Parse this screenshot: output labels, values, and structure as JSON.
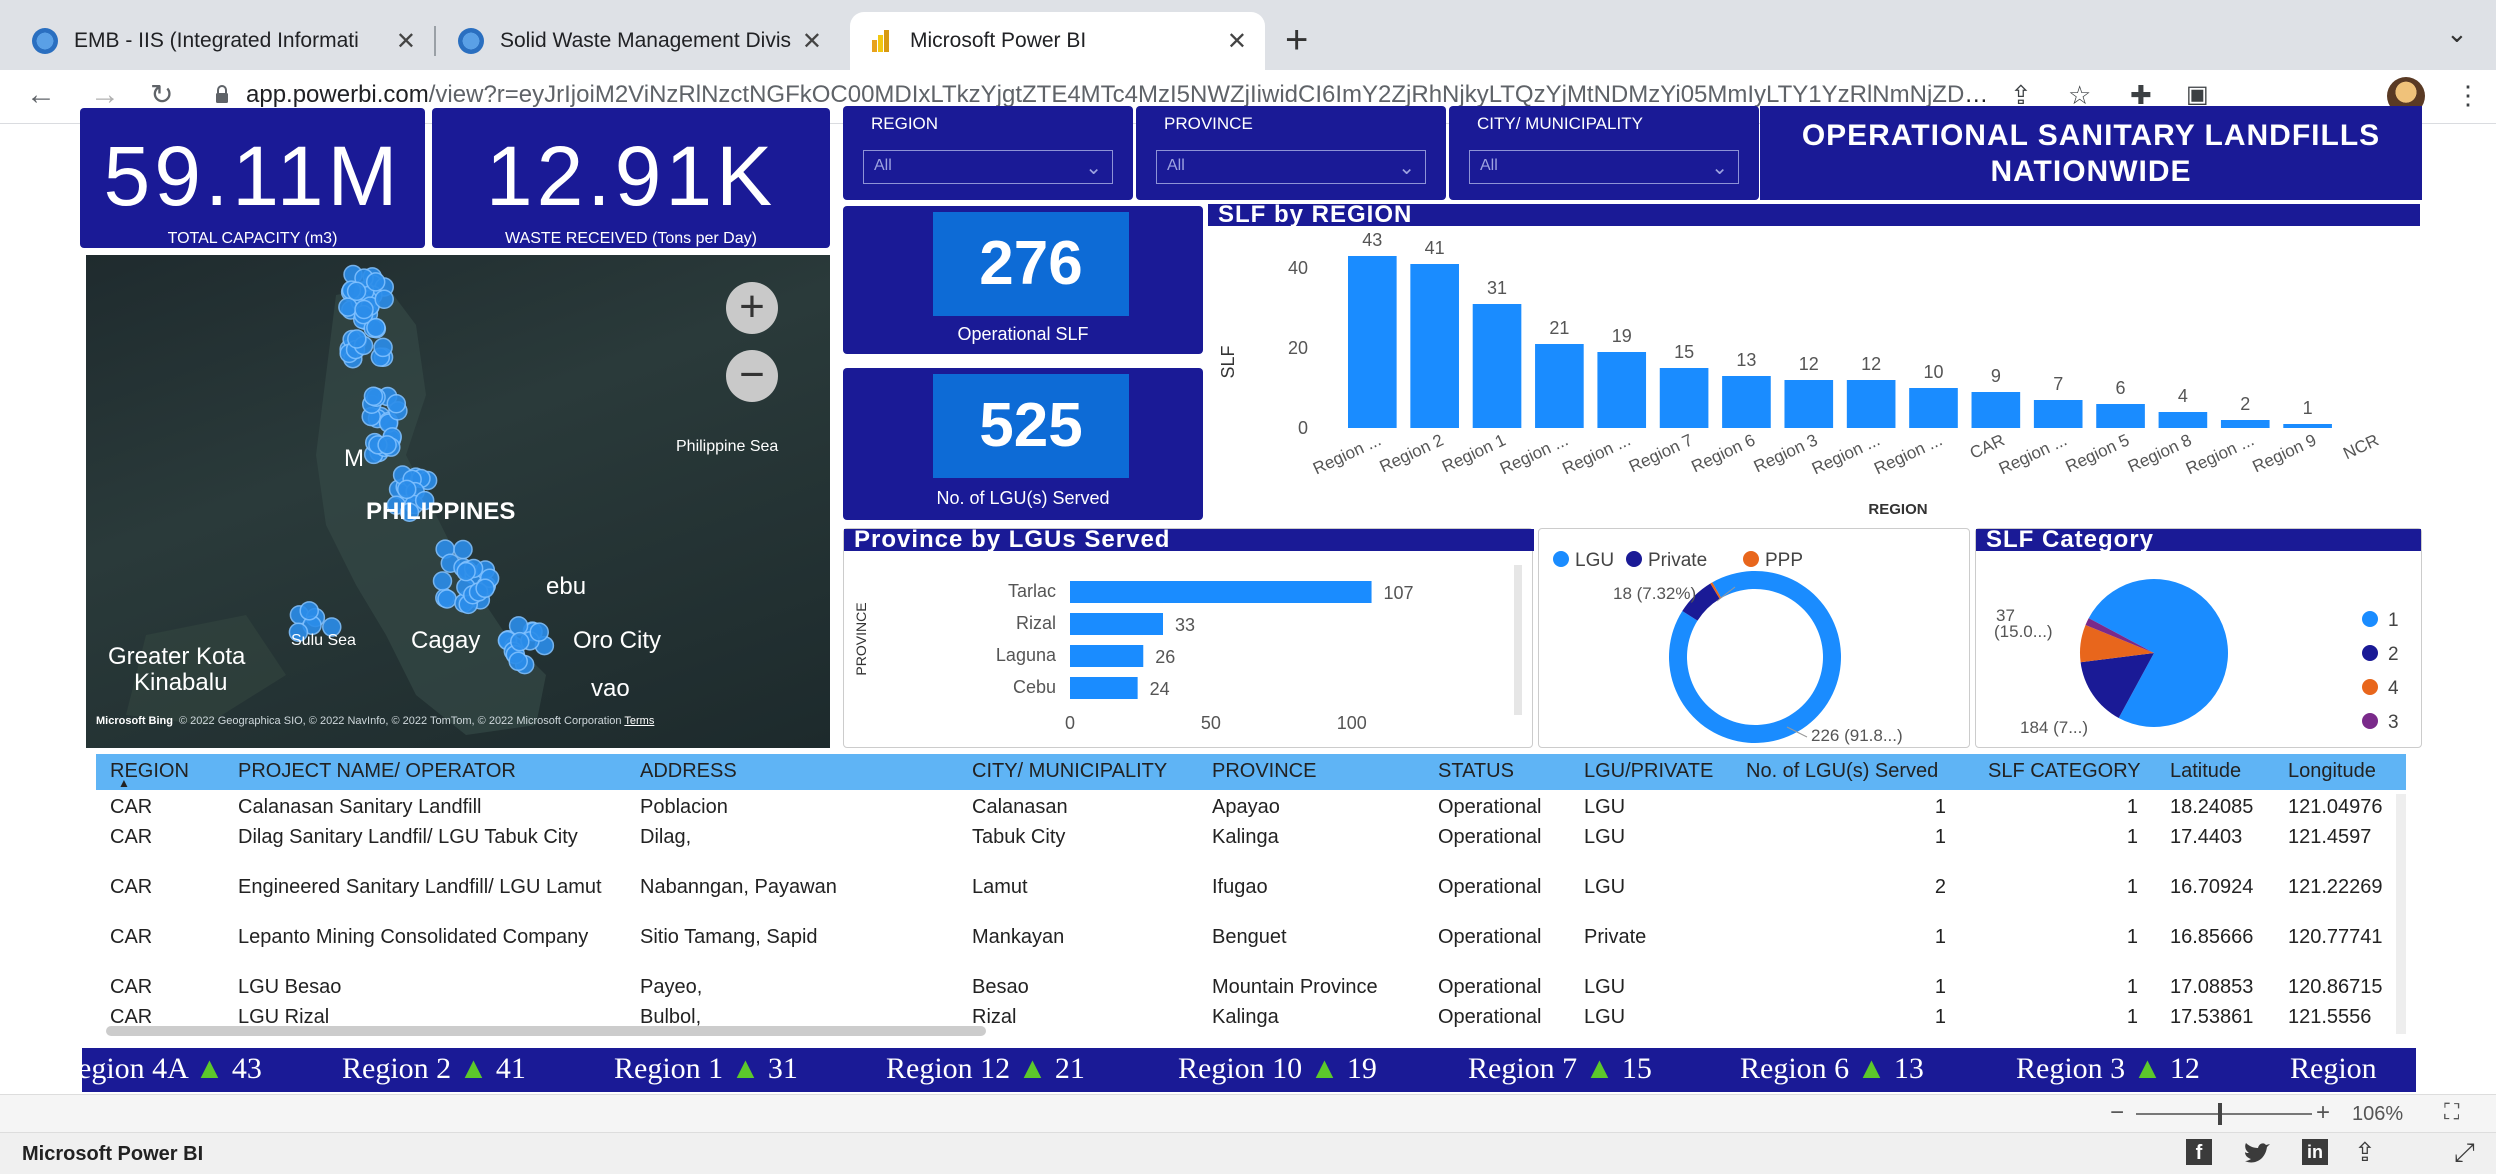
{
  "browser": {
    "tabs": [
      {
        "label": "EMB - IIS (Integrated Informati"
      },
      {
        "label": "Solid Waste Management Divis"
      },
      {
        "label": "Microsoft Power BI"
      }
    ],
    "url_host": "app.powerbi.com",
    "url_rest": "/view?r=eyJrIjoiM2ViNzRlNzctNGFkOC00MDIxLTkzYjgtZTE4MTc4MzI5NWZjIiwidCI6ImY2ZjRhNjkyLTQzYjMtNDMzYi05MmIyLTY1YzRlNmNjZDkyMCIsI..."
  },
  "kpis": {
    "total_capacity": "59.11M",
    "total_capacity_label": "TOTAL CAPACITY (m3)",
    "waste_received": "12.91K",
    "waste_received_label": "WASTE RECEIVED (Tons per Day)"
  },
  "slicers": {
    "region_label": "REGION",
    "province_label": "PROVINCE",
    "city_label": "CITY/ MUNICIPALITY",
    "all": "All"
  },
  "title": "OPERATIONAL SANITARY LANDFILLS NATIONWIDE",
  "cards": {
    "operational_slf": "276",
    "operational_slf_label": "Operational SLF",
    "lgu_served": "525",
    "lgu_served_label": "No. of LGU(s) Served"
  },
  "map": {
    "labels": [
      "Philippine Sea",
      "PHILIPPINES",
      "Sulu Sea",
      "Cagay",
      "Oro City",
      "Greater Kota",
      "Kinabalu",
      "ebu",
      "vao",
      "M"
    ],
    "copyright": "© 2022 Geographica SIO, © 2022 NavInfo, © 2022 TomTom, © 2022 Microsoft Corporation",
    "terms": "Terms",
    "bing": "Microsoft Bing"
  },
  "chart_data": [
    {
      "type": "bar",
      "title": "SLF by REGION",
      "xlabel": "REGION",
      "ylabel": "SLF",
      "ylim": [
        0,
        45
      ],
      "yticks": [
        0,
        20,
        40
      ],
      "categories": [
        "Region ...",
        "Region 2",
        "Region 1",
        "Region ...",
        "Region ...",
        "Region 7",
        "Region 6",
        "Region 3",
        "Region ...",
        "Region ...",
        "CAR",
        "Region ...",
        "Region 5",
        "Region 8",
        "Region ...",
        "Region 9",
        "NCR"
      ],
      "values": [
        43,
        41,
        31,
        21,
        19,
        15,
        13,
        12,
        12,
        10,
        9,
        7,
        6,
        4,
        2,
        1
      ],
      "color": "#1a8cff"
    },
    {
      "type": "bar",
      "orientation": "horizontal",
      "title": "Province by LGUs Served",
      "ylabel": "PROVINCE",
      "xticks": [
        0,
        50,
        100
      ],
      "categories": [
        "Tarlac",
        "Rizal",
        "Laguna",
        "Cebu"
      ],
      "values": [
        107,
        33,
        26,
        24
      ],
      "color": "#1a8cff"
    },
    {
      "type": "pie",
      "donut": true,
      "legend": [
        "LGU",
        "Private",
        "PPP"
      ],
      "colors": [
        "#1a8cff",
        "#1a1a96",
        "#e8661c"
      ],
      "values": [
        226,
        18,
        1
      ],
      "labels": [
        "226 (91.8...)",
        "18 (7.32%)"
      ]
    },
    {
      "type": "pie",
      "title": "SLF Category",
      "legend": [
        "1",
        "2",
        "4",
        "3"
      ],
      "colors": [
        "#1a8cff",
        "#1a1a96",
        "#e8661c",
        "#7a2a8a"
      ],
      "values": [
        184,
        37,
        20,
        4
      ],
      "labels": [
        "37 (15.0...)",
        "184 (7...)"
      ]
    }
  ],
  "table": {
    "headers": [
      "REGION",
      "PROJECT NAME/ OPERATOR",
      "ADDRESS",
      "CITY/ MUNICIPALITY",
      "PROVINCE",
      "STATUS",
      "LGU/PRIVATE",
      "No. of LGU(s) Served",
      "SLF CATEGORY",
      "Latitude",
      "Longitude"
    ],
    "rows": [
      [
        "CAR",
        "Calanasan Sanitary Landfill",
        "Poblacion",
        "Calanasan",
        "Apayao",
        "Operational",
        "LGU",
        "1",
        "1",
        "18.24085",
        "121.04976"
      ],
      [
        "CAR",
        "Dilag Sanitary Landfil/ LGU Tabuk City",
        "Dilag,",
        "Tabuk City",
        "Kalinga",
        "Operational",
        "LGU",
        "1",
        "1",
        "17.4403",
        "121.4597"
      ],
      [
        "CAR",
        "Engineered Sanitary Landfill/ LGU Lamut",
        "Nabanngan, Payawan",
        "Lamut",
        "Ifugao",
        "Operational",
        "LGU",
        "2",
        "1",
        "16.70924",
        "121.22269"
      ],
      [
        "CAR",
        "Lepanto Mining Consolidated Company",
        "Sitio Tamang, Sapid",
        "Mankayan",
        "Benguet",
        "Operational",
        "Private",
        "1",
        "1",
        "16.85666",
        "120.77741"
      ],
      [
        "CAR",
        "LGU Besao",
        "Payeo,",
        "Besao",
        "Mountain Province",
        "Operational",
        "LGU",
        "1",
        "1",
        "17.08853",
        "120.86715"
      ],
      [
        "CAR",
        "LGU Rizal",
        "Bulbol,",
        "Rizal",
        "Kalinga",
        "Operational",
        "LGU",
        "1",
        "1",
        "17.53861",
        "121.5556"
      ]
    ]
  },
  "ticker": [
    {
      "region": "egion 4A",
      "value": "43"
    },
    {
      "region": "Region 2",
      "value": "41"
    },
    {
      "region": "Region 1",
      "value": "31"
    },
    {
      "region": "Region 12",
      "value": "21"
    },
    {
      "region": "Region 10",
      "value": "19"
    },
    {
      "region": "Region 7",
      "value": "15"
    },
    {
      "region": "Region 6",
      "value": "13"
    },
    {
      "region": "Region 3",
      "value": "12"
    },
    {
      "region": "Region",
      "value": ""
    }
  ],
  "zoom": "106%",
  "status_title": "Microsoft Power BI",
  "colors": {
    "navy": "#1a1a96",
    "accent": "#1a8cff",
    "header": "#5fb4f5",
    "ppp": "#e8661c"
  }
}
